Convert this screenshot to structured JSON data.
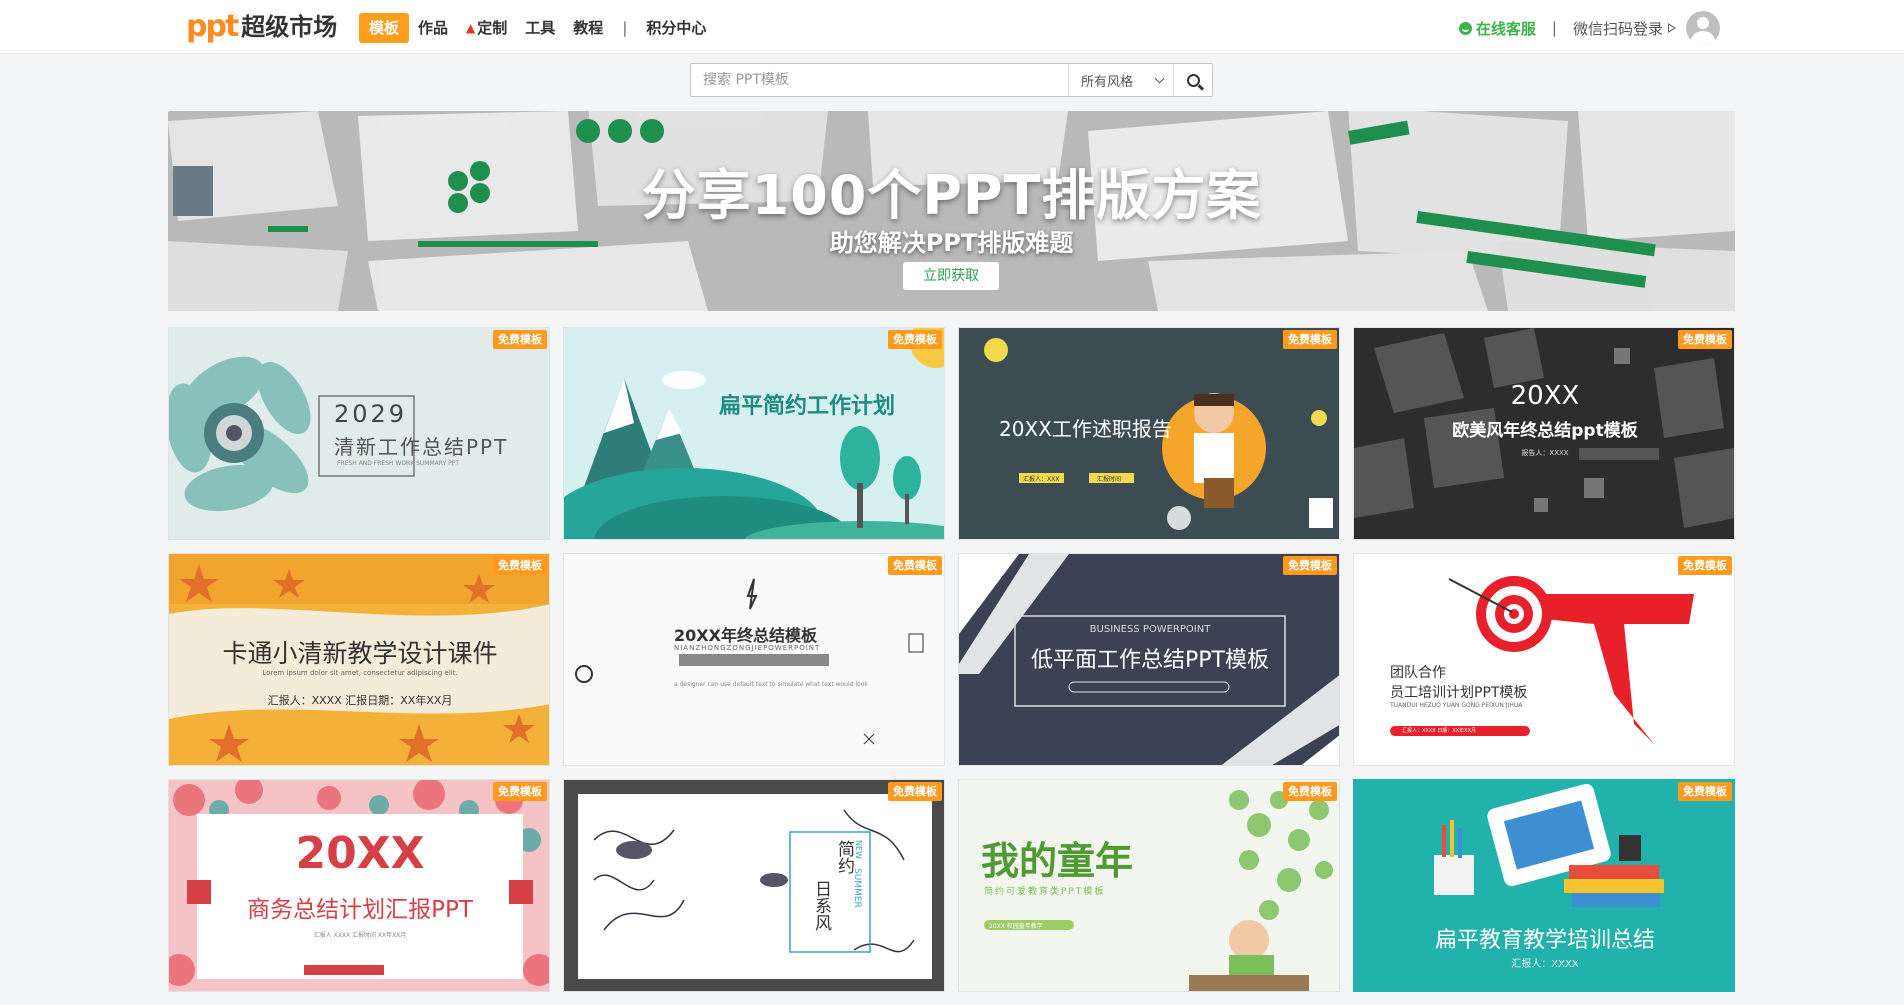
{
  "header": {
    "logo_mark": "ppt",
    "logo_text": "超级市场",
    "nav": [
      "模板",
      "作品",
      "定制",
      "工具",
      "教程",
      "积分中心"
    ],
    "nav_sep": "|",
    "service_label": "在线客服",
    "right_sep": "|",
    "login_label": "微信扫码登录"
  },
  "search": {
    "placeholder": "搜索 PPT模板",
    "style_selected": "所有风格"
  },
  "banner": {
    "title": "分享100个PPT排版方案",
    "subtitle": "助您解决PPT排版难题",
    "button": "立即获取"
  },
  "badge_label": "免费模板",
  "cards": [
    {
      "l1": "2029",
      "l2": "清新工作总结PPT",
      "l3": "FRESH AND FRESH WORK SUMMARY PPT"
    },
    {
      "l1": "扁平简约工作计划"
    },
    {
      "l1": "20XX工作述职报告",
      "l2": "汇报人：XXX",
      "l3": "汇报时间"
    },
    {
      "l1": "20XX",
      "l2": "欧美风年终总结ppt模板",
      "l3": "报告人：XXXX"
    },
    {
      "l1": "卡通小清新教学设计课件",
      "l2": "Lorem ipsum dolor sit amet, consectetur adipiscing elit.",
      "l3": "汇报人：XXXX    汇报日期：XX年XX月"
    },
    {
      "l1": "20XX年终总结模板",
      "l2": "NIANZHONGZONGJIEPOWERPOINT",
      "l3": "a designer can use default text to simulate what text would look"
    },
    {
      "l1": "BUSINESS POWERPOINT",
      "l2": "低平面工作总结PPT模板"
    },
    {
      "l1": "团队合作",
      "l2": "员工培训计划PPT模板",
      "l3": "TUANDUI HEZUO YUAN GONG PEIXUN JIHUA",
      "l4": "汇报人：XXXX    日期：XX年XX月"
    },
    {
      "l1": "20XX",
      "l2": "商务总结计划汇报PPT",
      "l3": "汇报人 XXXX    汇报时间 XX年XX月"
    },
    {
      "l1": "简约",
      "l2": "日系风",
      "l3": "SUMMER",
      "l4": "NEW"
    },
    {
      "l1": "我的童年",
      "l2": "简约可爱教育类PPT模板",
      "l3": "20XX 校园童年教学"
    },
    {
      "l1": "扁平教育教学培训总结",
      "l2": "汇报人：XXXX"
    }
  ]
}
